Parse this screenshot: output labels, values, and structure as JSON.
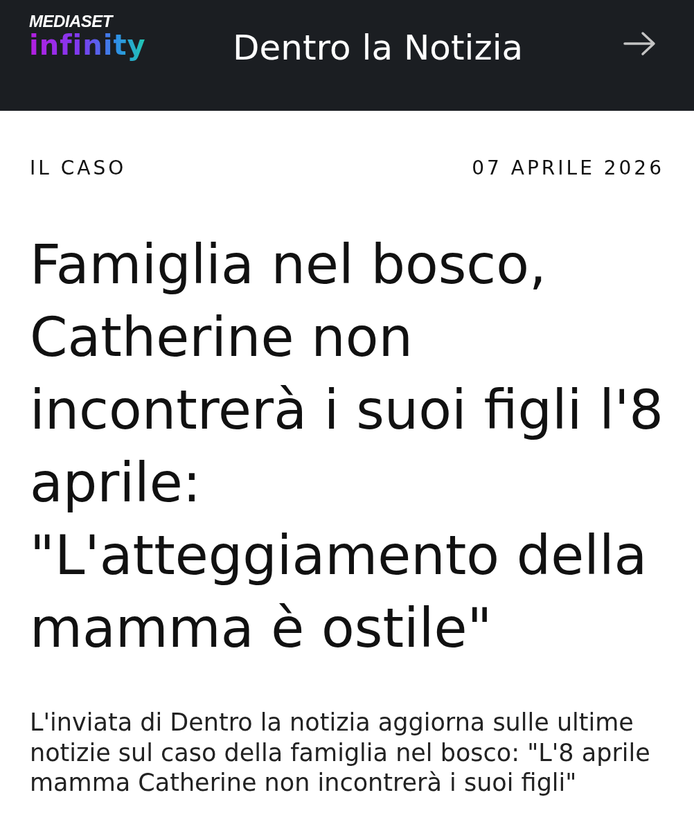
{
  "header": {
    "logo": {
      "brand": "MEDIASET",
      "product": "infinity"
    },
    "title": "Dentro la Notizia"
  },
  "article": {
    "category": "IL CASO",
    "date": "07 APRILE 2026",
    "headline": "Famiglia nel bosco, Catherine non incontrerà i suoi figli l'8 aprile: \"L'atteggiamento della mamma è ostile\"",
    "summary": "L'inviata di Dentro la notizia aggiorna sulle ultime notizie sul caso della famiglia nel bosco: \"L'8 aprile mamma Catherine non incontrerà i suoi figli\""
  }
}
